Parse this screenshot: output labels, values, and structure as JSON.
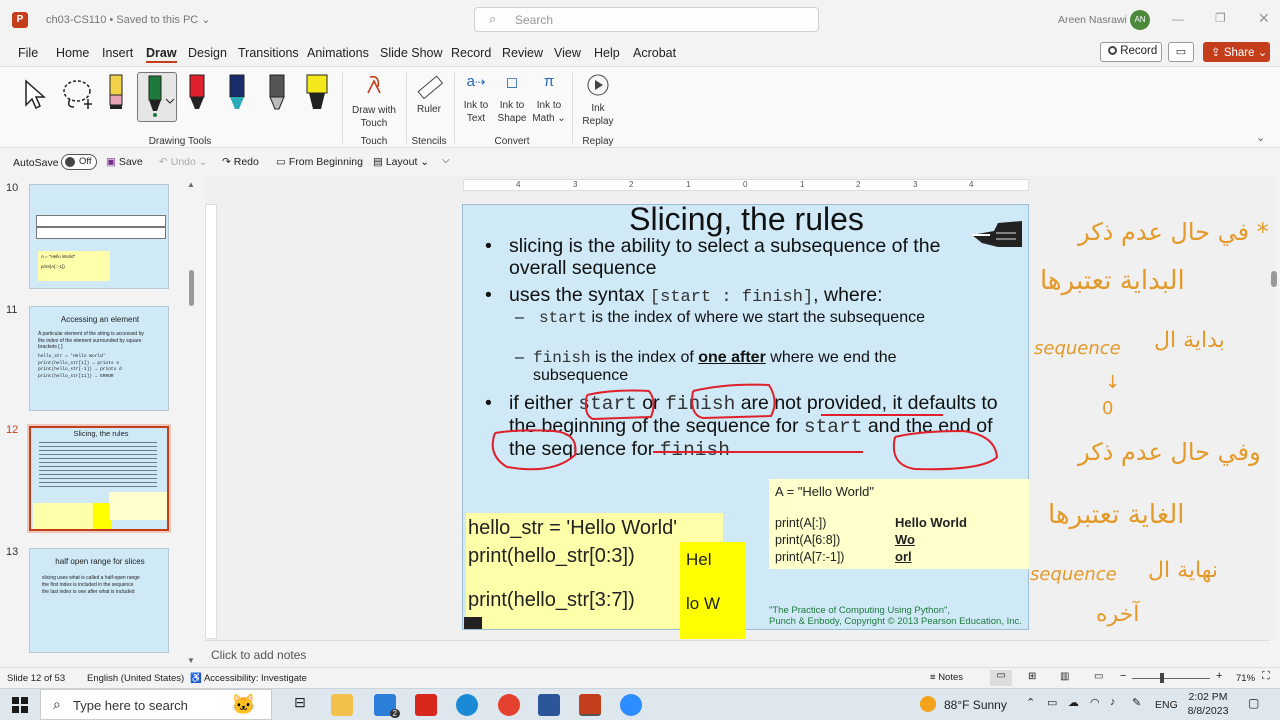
{
  "title_bar": {
    "doc_title": "ch03-CS110 • Saved to this PC",
    "search_placeholder": "Search",
    "user_name": "Areen Nasrawi",
    "user_initials": "AN"
  },
  "menu": {
    "items": [
      "File",
      "Home",
      "Insert",
      "Draw",
      "Design",
      "Transitions",
      "Animations",
      "Slide Show",
      "Record",
      "Review",
      "View",
      "Help",
      "Acrobat"
    ],
    "active": "Draw",
    "record_label": "Record",
    "share_label": "Share"
  },
  "ribbon": {
    "group_drawing_tools": "Drawing Tools",
    "group_touch": "Touch",
    "draw_with_touch": "Draw with Touch",
    "group_stencils": "Stencils",
    "ruler": "Ruler",
    "group_convert": "Convert",
    "ink_to_text": "Ink to Text",
    "ink_to_shape": "Ink to Shape",
    "ink_to_math": "Ink to Math",
    "group_replay": "Replay",
    "ink_replay": "Ink Replay"
  },
  "qat": {
    "autosave": "AutoSave",
    "autosave_state": "Off",
    "save": "Save",
    "undo": "Undo",
    "redo": "Redo",
    "from_beginning": "From Beginning",
    "layout": "Layout"
  },
  "thumbnails": [
    {
      "num": "10",
      "line1": "A = \"Hello World\"",
      "line2": "print(A[::-1])"
    },
    {
      "num": "11",
      "title": "Accessing an element",
      "body": "A particular element of the string is accessed by the index of the element surrounded by square brackets [ ]",
      "code1": "hello_str = 'Hello World'",
      "code2": "print(hello_str[1])  → prints e",
      "code3": "print(hello_str[-1]) → prints d",
      "code4": "print(hello_str[11]) → ERROR"
    },
    {
      "num": "12",
      "title": "Slicing, the rules"
    },
    {
      "num": "13",
      "title": "half open range for slices",
      "b1": "slicing uses what is called a half-open range",
      "b2": "the first index is included in the sequence",
      "b3": "the last index is one after what is included"
    }
  ],
  "ruler_ticks": [
    "4",
    "3",
    "2",
    "1",
    "0",
    "1",
    "2",
    "3",
    "4"
  ],
  "slide": {
    "title": "Slicing, the rules",
    "b1": "slicing is the ability to select a subsequence of the overall sequence",
    "b2_pre": "uses the syntax ",
    "b2_code": "[start : finish]",
    "b2_post": ", where:",
    "s1_code": "start",
    "s1_text": " is the index of where we start the subsequence",
    "s2_code": "finish",
    "s2_pre": " is the index of ",
    "s2_bold": "one after",
    "s2_post": " where we end the subsequence",
    "b3_pre": "if either ",
    "b3_code1": "start",
    "b3_or": " or ",
    "b3_code2": "finish",
    "b3_mid": " are not provided, it defaults to the beginning of the sequence for ",
    "b3_code3": "start",
    "b3_and": " and the end of the sequence for ",
    "b3_code4": "finish",
    "code1": "hello_str = 'Hello World'",
    "code2": "print(hello_str[0:3])",
    "code3": "print(hello_str[3:7])",
    "out1": "Hel",
    "out2": "lo W",
    "box_title": "A = \"Hello World\"",
    "box_rows": [
      {
        "code": "print(A[:])",
        "out": "Hello World"
      },
      {
        "code": "print(A[6:8])",
        "out": "Wo"
      },
      {
        "code": "print(A[7:-1])",
        "out": "orl"
      }
    ],
    "credit1": "\"The Practice of Computing Using Python\",",
    "credit2": "Punch & Enbody, Copyright © 2013 Pearson Education, Inc."
  },
  "annotations": {
    "a1": "في حال عدم ذكر *",
    "a2": "البداية تعتبرها",
    "a3": "بداية ال",
    "a4": "sequence",
    "a5": "0",
    "a6": "وفي حال عدم ذكر",
    "a7": "الغاية تعتبرها",
    "a8": "نهاية ال",
    "a9": "sequence",
    "a10": "آخره"
  },
  "notes_placeholder": "Click to add notes",
  "status": {
    "slide": "Slide 12 of 53",
    "language": "English (United States)",
    "accessibility": "Accessibility: Investigate",
    "notes": "Notes",
    "zoom": "71%"
  },
  "taskbar": {
    "search": "Type here to search",
    "weather": "88°F  Sunny",
    "lang": "ENG",
    "time": "2:02 PM",
    "date": "8/8/2023",
    "mail_badge": "2"
  },
  "colors": {
    "accent": "#c43e1c",
    "ink_red": "#e0202a",
    "ink_orange": "#e39a2a",
    "slide_bg": "#cfe9f7",
    "yellow": "#ffff00",
    "pale_yellow": "#ffffcc"
  }
}
